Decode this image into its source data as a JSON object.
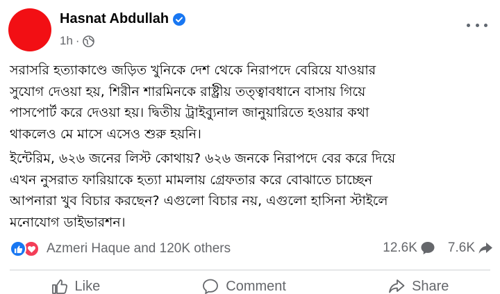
{
  "post": {
    "author": "Hasnat Abdullah",
    "time": "1h",
    "meta_dot": "·",
    "paragraphs": [
      "সরাসরি হত্যাকাণ্ডে জড়িত খুনিকে দেশ থেকে নিরাপদে বেরিয়ে যাওয়ার\nসুযোগ দেওয়া হয়, শিরীন শারমিনকে রাষ্ট্রীয় তত্ত্বাবধানে বাসায় গিয়ে\nপাসপোর্ট করে দেওয়া হয়। দ্বিতীয় ট্রাইব্যুনাল জানুয়ারিতে হওয়ার কথা\nথাকলেও মে মাসে এসেও শুরু হয়নি।",
      "ইন্টেরিম, ৬২৬ জনের লিস্ট কোথায়? ৬২৬ জনকে নিরাপদে বের করে দিয়ে\nএখন নুসরাত ফারিয়াকে হত্যা মামলায় গ্রেফতার করে বোঝাতে চাচ্ছেন\nআপনারা খুব বিচার করছেন? এগুলো বিচার নয়, এগুলো হাসিনা স্টাইলে\nমনোযোগ ডাইভারশন।"
    ]
  },
  "reactions": {
    "names": "Azmeri Haque and 120K others",
    "comments": "12.6K",
    "shares": "7.6K"
  },
  "actions": {
    "like": "Like",
    "comment": "Comment",
    "share": "Share"
  },
  "colors": {
    "avatar": "#f20f14",
    "brand_blue": "#1877f2",
    "love": "#f33e58",
    "secondary_text": "#65676b"
  },
  "icons": [
    "verified-badge-icon",
    "globe-icon",
    "more-options-icon",
    "like-reaction-icon",
    "love-reaction-icon",
    "comment-icon",
    "share-icon",
    "thumbs-up-icon"
  ]
}
